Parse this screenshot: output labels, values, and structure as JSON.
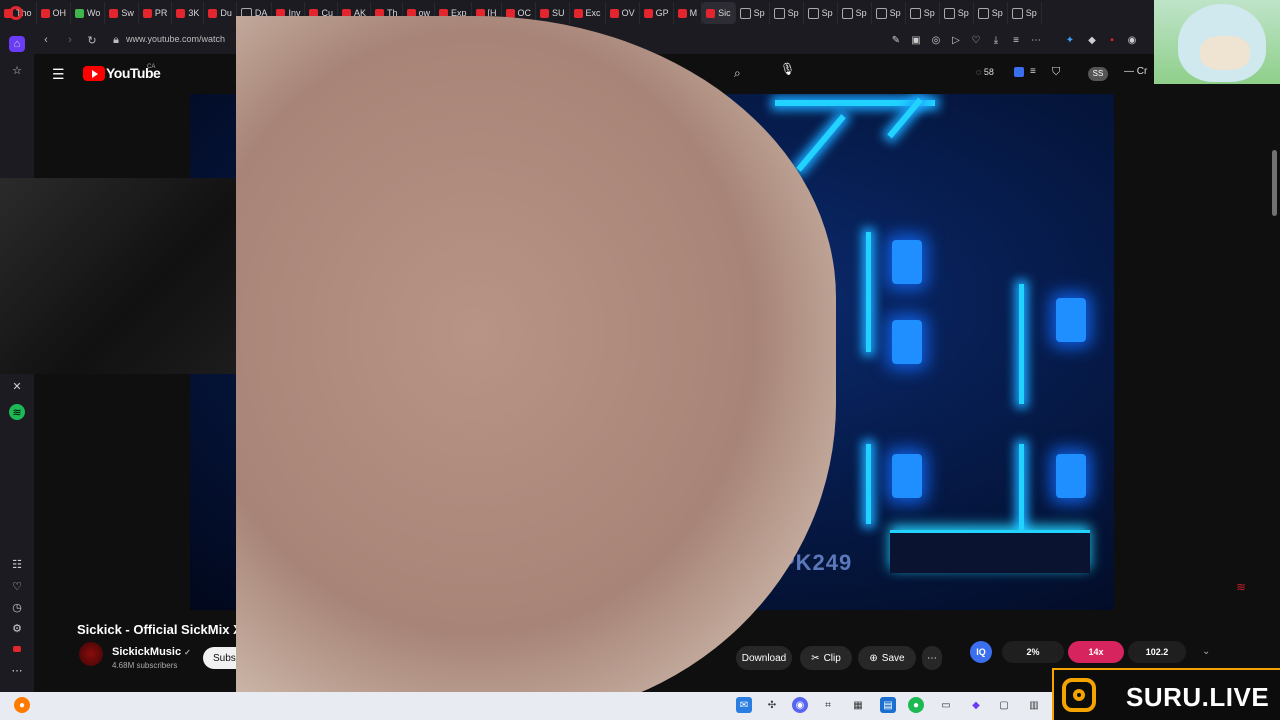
{
  "browser": {
    "tabs": [
      {
        "label": "Tho",
        "favicon": "youtube"
      },
      {
        "label": "OH",
        "favicon": "youtube"
      },
      {
        "label": "Wo",
        "favicon": "green"
      },
      {
        "label": "Sw",
        "favicon": "youtube"
      },
      {
        "label": "PR",
        "favicon": "youtube"
      },
      {
        "label": "3K",
        "favicon": "youtube"
      },
      {
        "label": "Du",
        "favicon": "youtube"
      },
      {
        "label": "DA",
        "favicon": "generic"
      },
      {
        "label": "Inv",
        "favicon": "youtube"
      },
      {
        "label": "Cu",
        "favicon": "youtube"
      },
      {
        "label": "AK",
        "favicon": "youtube"
      },
      {
        "label": "Th",
        "favicon": "youtube"
      },
      {
        "label": "ow",
        "favicon": "youtube"
      },
      {
        "label": "Exp",
        "favicon": "youtube"
      },
      {
        "label": "[H",
        "favicon": "youtube"
      },
      {
        "label": "OC",
        "favicon": "youtube"
      },
      {
        "label": "SU",
        "favicon": "youtube"
      },
      {
        "label": "Exc",
        "favicon": "youtube"
      },
      {
        "label": "OV",
        "favicon": "youtube"
      },
      {
        "label": "GP",
        "favicon": "youtube"
      },
      {
        "label": "M",
        "favicon": "youtube"
      },
      {
        "label": "Sic",
        "favicon": "youtube",
        "active": true
      },
      {
        "label": "Sp",
        "favicon": "generic"
      },
      {
        "label": "Sp",
        "favicon": "generic"
      },
      {
        "label": "Sp",
        "favicon": "generic"
      },
      {
        "label": "Sp",
        "favicon": "generic"
      },
      {
        "label": "Sp",
        "favicon": "generic"
      },
      {
        "label": "Sp",
        "favicon": "generic"
      },
      {
        "label": "Sp",
        "favicon": "generic"
      },
      {
        "label": "Sp",
        "favicon": "generic"
      },
      {
        "label": "Sp",
        "favicon": "generic"
      }
    ],
    "url": "www.youtube.com/watch"
  },
  "youtube": {
    "brand": "YouTube",
    "country": "CA",
    "notif_count": "58",
    "avatar_initials": "SS",
    "create_label": "Cr"
  },
  "video": {
    "watermark": "PK249",
    "title": "Sickick - Official SickMix X",
    "channel": "SickickMusic",
    "subscribers": "4.68M subscribers",
    "subscribe_label": "Subs",
    "actions": {
      "download": "Download",
      "clip": "Clip",
      "save": "Save",
      "more": "⋯"
    }
  },
  "stream_widget": {
    "icon": "IQ",
    "percent": "2%",
    "multiplier": "14x",
    "value": "102.2"
  },
  "overlay": {
    "banner": "SURU.LIVE"
  },
  "colors": {
    "accent_red": "#ff0000",
    "widget_pink": "#d6245f",
    "banner_orange": "#f5a300"
  }
}
